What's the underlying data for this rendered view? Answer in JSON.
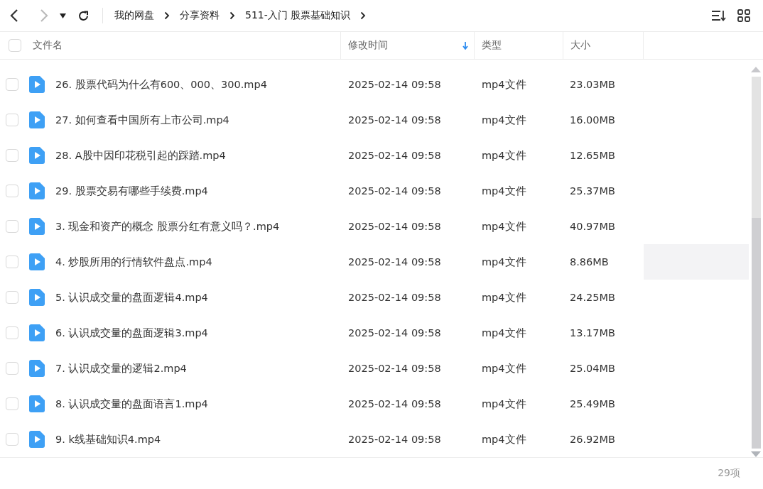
{
  "breadcrumb": [
    "我的网盘",
    "分享资料",
    "511-入门 股票基础知识"
  ],
  "nav": {
    "back_disabled": false,
    "forward_disabled": true
  },
  "columns": [
    {
      "label": "文件名",
      "sorted": false
    },
    {
      "label": "修改时间",
      "sorted": true
    },
    {
      "label": "类型",
      "sorted": false
    },
    {
      "label": "大小",
      "sorted": false
    }
  ],
  "rows": [
    {
      "name": "26. 股票代码为什么有600、000、300.mp4",
      "modified": "2025-02-14 09:58",
      "type": "mp4文件",
      "size": "23.03MB",
      "checked": false,
      "hovered": false
    },
    {
      "name": "27. 如何查看中国所有上市公司.mp4",
      "modified": "2025-02-14 09:58",
      "type": "mp4文件",
      "size": "16.00MB",
      "checked": false,
      "hovered": false
    },
    {
      "name": "28. A股中因印花税引起的踩踏.mp4",
      "modified": "2025-02-14 09:58",
      "type": "mp4文件",
      "size": "12.65MB",
      "checked": false,
      "hovered": false
    },
    {
      "name": "29. 股票交易有哪些手续费.mp4",
      "modified": "2025-02-14 09:58",
      "type": "mp4文件",
      "size": "25.37MB",
      "checked": false,
      "hovered": false
    },
    {
      "name": "3. 现金和资产的概念 股票分红有意义吗？.mp4",
      "modified": "2025-02-14 09:58",
      "type": "mp4文件",
      "size": "40.97MB",
      "checked": false,
      "hovered": false
    },
    {
      "name": "4. 炒股所用的行情软件盘点.mp4",
      "modified": "2025-02-14 09:58",
      "type": "mp4文件",
      "size": "8.86MB",
      "checked": false,
      "hovered": true
    },
    {
      "name": "5. 认识成交量的盘面逻辑4.mp4",
      "modified": "2025-02-14 09:58",
      "type": "mp4文件",
      "size": "24.25MB",
      "checked": false,
      "hovered": false
    },
    {
      "name": "6. 认识成交量的盘面逻辑3.mp4",
      "modified": "2025-02-14 09:58",
      "type": "mp4文件",
      "size": "13.17MB",
      "checked": false,
      "hovered": false
    },
    {
      "name": "7. 认识成交量的逻辑2.mp4",
      "modified": "2025-02-14 09:58",
      "type": "mp4文件",
      "size": "25.04MB",
      "checked": false,
      "hovered": false
    },
    {
      "name": "8. 认识成交量的盘面语言1.mp4",
      "modified": "2025-02-14 09:58",
      "type": "mp4文件",
      "size": "25.49MB",
      "checked": false,
      "hovered": false
    },
    {
      "name": "9. k线基础知识4.mp4",
      "modified": "2025-02-14 09:58",
      "type": "mp4文件",
      "size": "26.92MB",
      "checked": false,
      "hovered": false
    }
  ],
  "footer": {
    "count": "29项"
  }
}
